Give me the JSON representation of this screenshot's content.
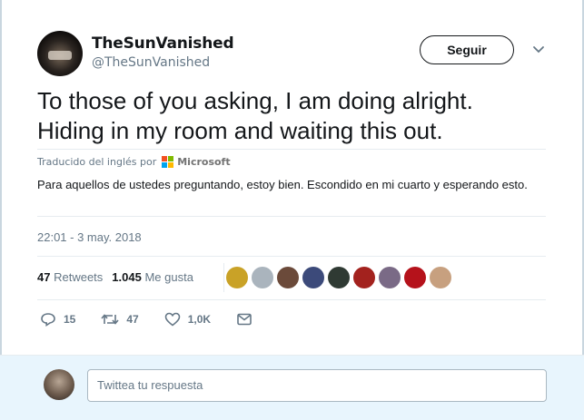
{
  "header": {
    "display_name": "TheSunVanished",
    "handle": "@TheSunVanished",
    "follow_label": "Seguir"
  },
  "tweet": {
    "text_line1": "To those of you asking, I am doing alright.",
    "text_line2": "Hiding in my room and waiting this out.",
    "translated_from": "Traducido del inglés por",
    "translator": "Microsoft",
    "translation": "Para aquellos de ustedes preguntando, estoy bien. Escondido en mi cuarto y esperando esto.",
    "timestamp": "22:01 - 3 may. 2018"
  },
  "stats": {
    "retweets_count": "47",
    "retweets_label": "Retweets",
    "likes_count": "1.045",
    "likes_label": "Me gusta"
  },
  "likers": [
    {
      "name": "liker-avatar-1",
      "color": "#c9a227"
    },
    {
      "name": "liker-avatar-2",
      "color": "#aab4bd"
    },
    {
      "name": "liker-avatar-3",
      "color": "#6b4a3a"
    },
    {
      "name": "liker-avatar-4",
      "color": "#3c4a7a"
    },
    {
      "name": "liker-avatar-5",
      "color": "#2f3a33"
    },
    {
      "name": "liker-avatar-6",
      "color": "#a3221e"
    },
    {
      "name": "liker-avatar-7",
      "color": "#7a6a86"
    },
    {
      "name": "liker-avatar-8",
      "color": "#b5121b"
    },
    {
      "name": "liker-avatar-9",
      "color": "#c7a07f"
    }
  ],
  "actions": {
    "reply_count": "15",
    "retweet_count": "47",
    "like_count": "1,0K"
  },
  "reply_box": {
    "placeholder": "Twittea tu respuesta"
  },
  "colors": {
    "text": "#14171a",
    "muted": "#657786",
    "footer_bg": "#e8f5fd",
    "microsoft_red": "#f25022",
    "microsoft_green": "#7fba00",
    "microsoft_blue": "#00a4ef",
    "microsoft_yellow": "#ffb900"
  }
}
